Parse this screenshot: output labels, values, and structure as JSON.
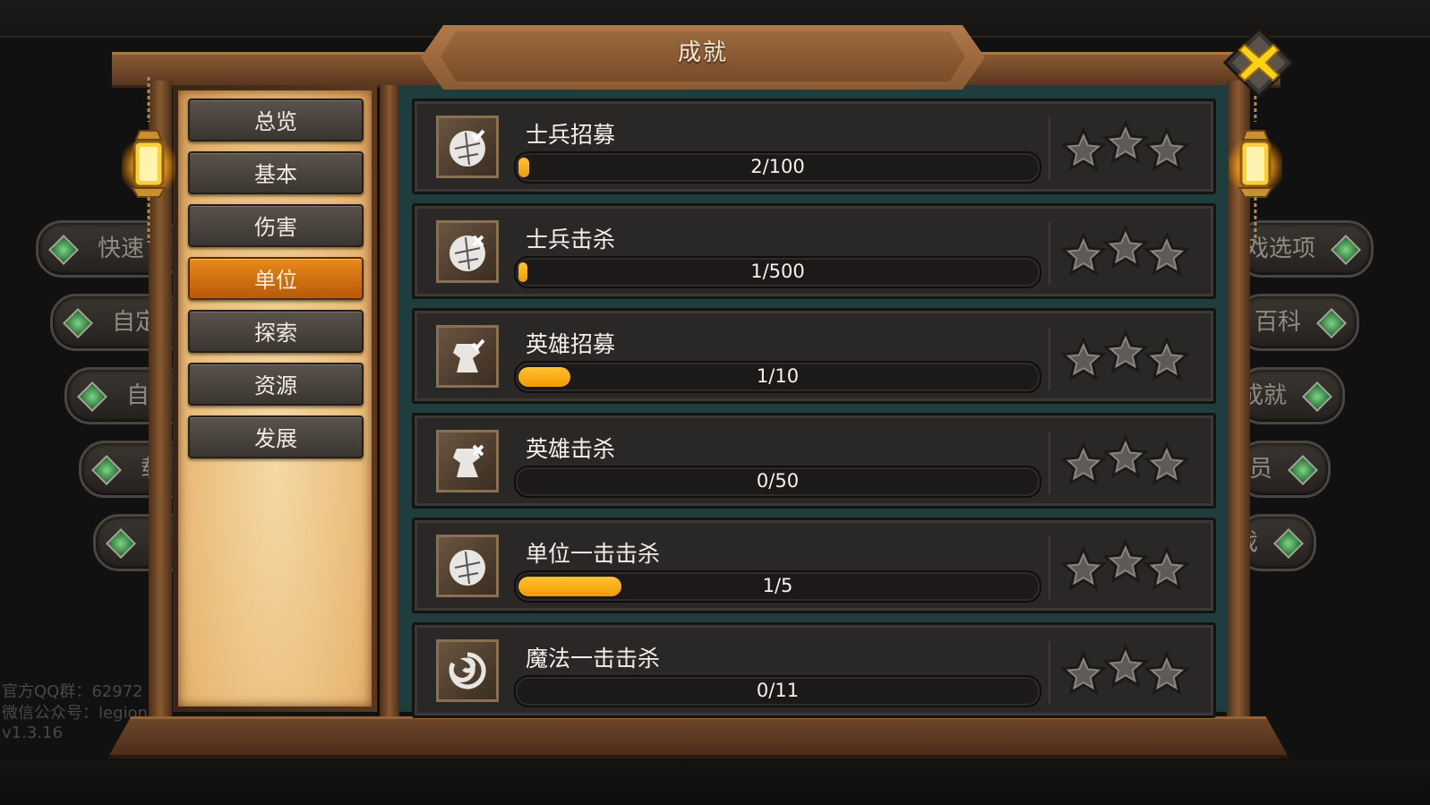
{
  "title": "成就",
  "nav": {
    "items": [
      "总览",
      "基本",
      "伤害",
      "单位",
      "探索",
      "资源",
      "发展"
    ],
    "active": "单位"
  },
  "achievements": [
    {
      "name": "士兵招募",
      "progress_text": "2/100",
      "progress": 0.02,
      "icon": "soldier-recruit-icon"
    },
    {
      "name": "士兵击杀",
      "progress_text": "1/500",
      "progress": 0.002,
      "icon": "soldier-kill-icon"
    },
    {
      "name": "英雄招募",
      "progress_text": "1/10",
      "progress": 0.1,
      "icon": "hero-recruit-icon"
    },
    {
      "name": "英雄击杀",
      "progress_text": "0/50",
      "progress": 0,
      "icon": "hero-kill-icon"
    },
    {
      "name": "单位一击击杀",
      "progress_text": "1/5",
      "progress": 0.2,
      "icon": "unit-oneshot-icon"
    },
    {
      "name": "魔法一击击杀",
      "progress_text": "0/11",
      "progress": 0,
      "icon": "magic-oneshot-icon"
    }
  ],
  "background_menu": {
    "left": [
      "快速",
      "自定",
      "自",
      "载",
      ""
    ],
    "right": [
      "戏选项",
      "百科",
      "成就",
      "员",
      "戏"
    ]
  },
  "info": {
    "qq": "官方QQ群：62972",
    "wechat": "微信公众号：legion",
    "version": "v1.3.16"
  },
  "colors": {
    "progress_fill": "#f29b00",
    "active_tab": "#d97210",
    "content_bg": "#1f3d3d"
  }
}
